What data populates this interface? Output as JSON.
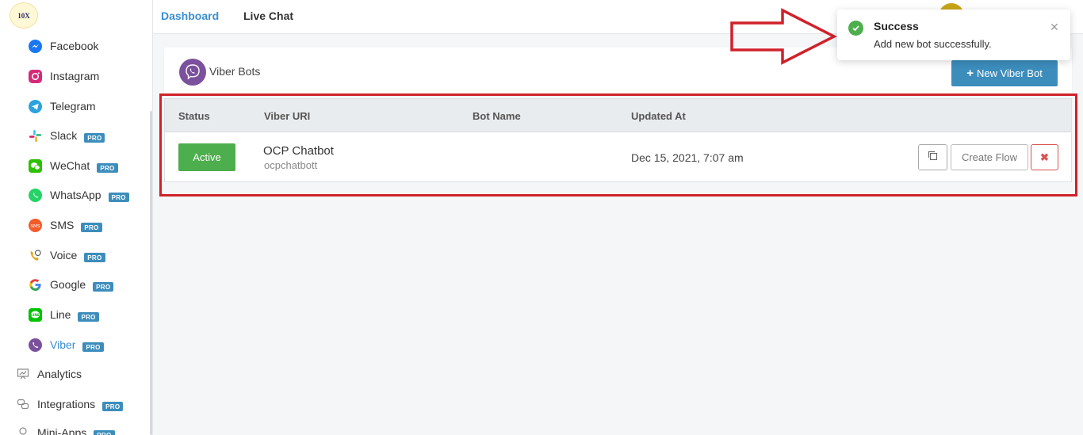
{
  "sidebar": {
    "logo_text": "10X",
    "items": [
      {
        "label": "Facebook",
        "pro": false,
        "icon": "facebook-messenger-icon"
      },
      {
        "label": "Instagram",
        "pro": false,
        "icon": "instagram-icon"
      },
      {
        "label": "Telegram",
        "pro": false,
        "icon": "telegram-icon"
      },
      {
        "label": "Slack",
        "pro": true,
        "icon": "slack-icon"
      },
      {
        "label": "WeChat",
        "pro": true,
        "icon": "wechat-icon"
      },
      {
        "label": "WhatsApp",
        "pro": true,
        "icon": "whatsapp-icon"
      },
      {
        "label": "SMS",
        "pro": true,
        "icon": "sms-icon"
      },
      {
        "label": "Voice",
        "pro": true,
        "icon": "voice-icon"
      },
      {
        "label": "Google",
        "pro": true,
        "icon": "google-icon"
      },
      {
        "label": "Line",
        "pro": true,
        "icon": "line-icon"
      },
      {
        "label": "Viber",
        "pro": true,
        "icon": "viber-icon",
        "active": true
      }
    ],
    "top_items": [
      {
        "label": "Analytics",
        "pro": false,
        "icon": "analytics-icon"
      },
      {
        "label": "Integrations",
        "pro": true,
        "icon": "integrations-icon"
      },
      {
        "label": "Mini-Apps",
        "pro": true,
        "icon": "mini-apps-icon"
      }
    ],
    "pro_label": "PRO"
  },
  "topbar": {
    "nav": [
      {
        "label": "Dashboard",
        "active": true
      },
      {
        "label": "Live Chat",
        "active": false
      }
    ]
  },
  "card": {
    "title": "Viber Bots",
    "new_button": "New Viber Bot"
  },
  "table": {
    "headers": [
      "Status",
      "Viber URI",
      "Bot Name",
      "Updated At"
    ],
    "rows": [
      {
        "status": "Active",
        "bot_title": "OCP Chatbot",
        "viber_uri": "ocpchatbott",
        "bot_name": "",
        "updated_at": "Dec 15, 2021, 7:07 am",
        "create_flow": "Create Flow"
      }
    ]
  },
  "toast": {
    "title": "Success",
    "message": "Add new bot successfully."
  },
  "colors": {
    "accent": "#3c8dbc",
    "active_green": "#4cae4c",
    "danger": "#d9534f",
    "highlight_red": "#d0212a",
    "viber_purple": "#7b519d"
  }
}
